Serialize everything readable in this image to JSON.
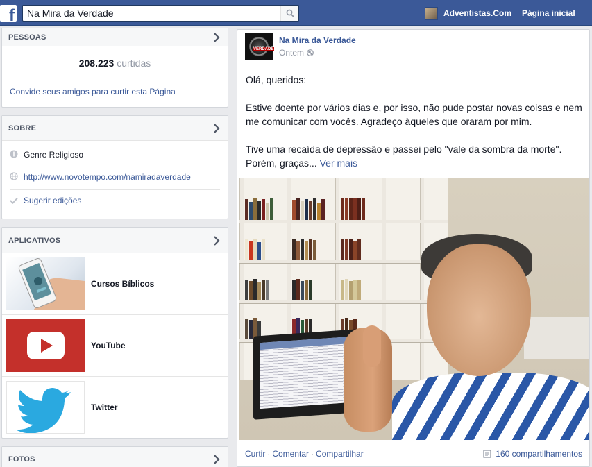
{
  "topbar": {
    "logo": "f",
    "search_value": "Na Mira da Verdade",
    "profile_name": "Adventistas.Com",
    "home_label": "Página inicial"
  },
  "pessoas": {
    "title": "PESSOAS",
    "likes_count": "208.223",
    "likes_suffix": "curtidas",
    "invite": "Convide seus amigos para curtir esta Página"
  },
  "sobre": {
    "title": "SOBRE",
    "genre": "Genre Religioso",
    "website": "http://www.novotempo.com/namiradaverdade",
    "suggest": "Sugerir edições"
  },
  "aplicativos": {
    "title": "APLICATIVOS",
    "items": [
      {
        "name": "Cursos Bíblicos"
      },
      {
        "name": "YouTube"
      },
      {
        "name": "Twitter"
      }
    ]
  },
  "fotos": {
    "title": "FOTOS"
  },
  "post": {
    "author": "Na Mira da Verdade",
    "avatar_tag": "VERDADE",
    "time": "Ontem",
    "para1": "Olá, queridos:",
    "para2": "Estive doente por vários dias e, por isso, não pude postar novas coisas e nem me comunicar com vocês. Agradeço àqueles que oraram por mim.",
    "para3": "Tive uma recaída de depressão e passei pelo \"vale da sombra da morte\". Porém, graças...",
    "see_more": "Ver mais",
    "like": "Curtir",
    "comment": "Comentar",
    "share": "Compartilhar",
    "shares_count": "160 compartilhamentos"
  },
  "colors": {
    "brand": "#3b5998",
    "link": "#3b5998",
    "background": "#e9eaed",
    "youtube_red": "#c4302b",
    "twitter_blue": "#2aa9e0"
  }
}
